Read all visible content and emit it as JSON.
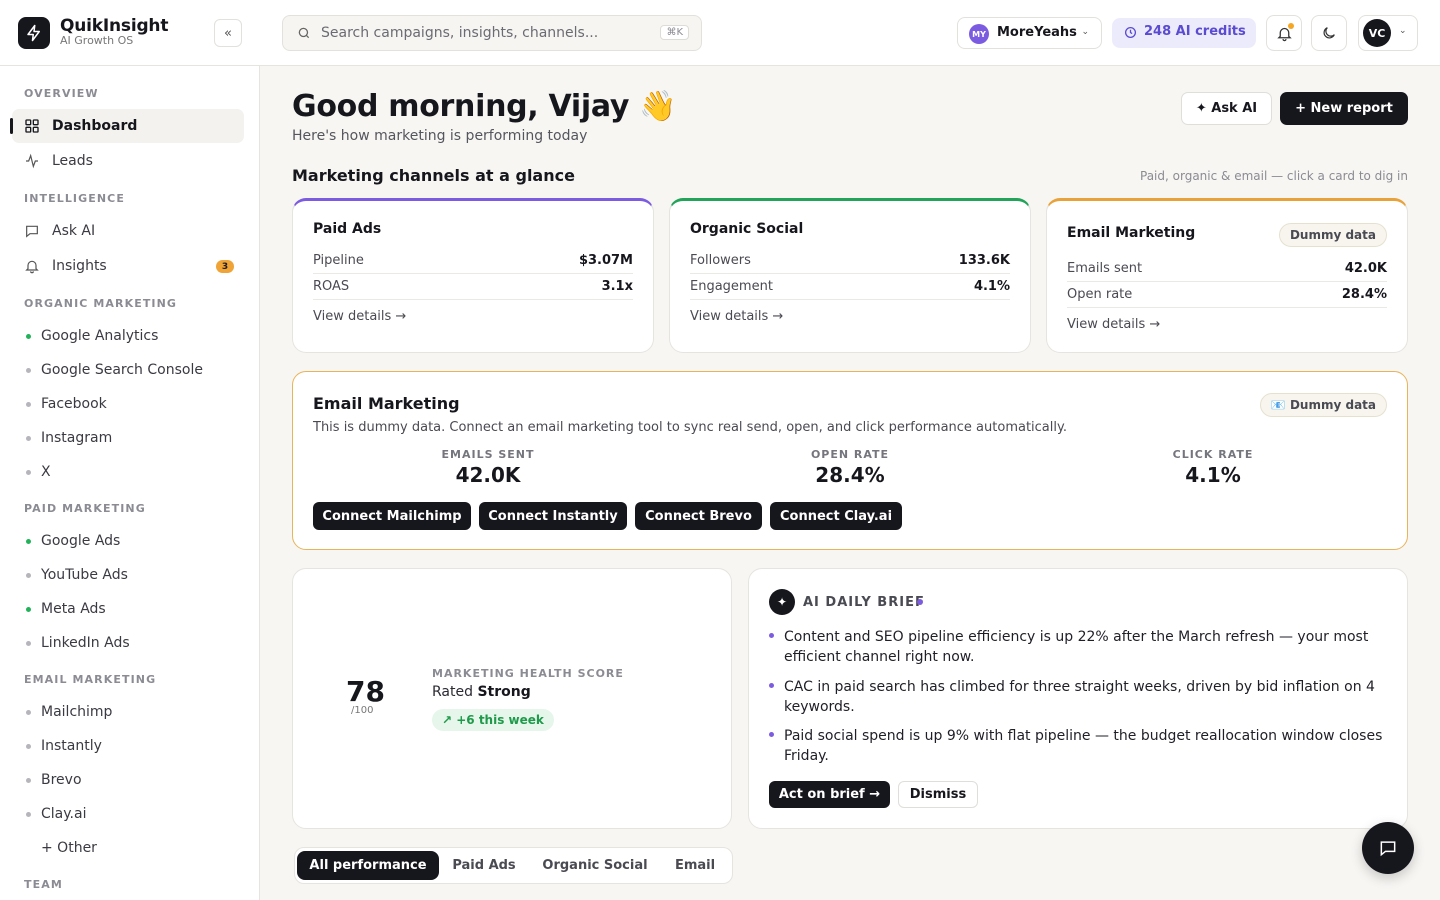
{
  "brand": {
    "name": "QuikInsight",
    "tagline": "AI Growth OS",
    "collapse_label": "«"
  },
  "search": {
    "placeholder": "Search campaigns, insights, channels...",
    "shortcut": "⌘K"
  },
  "workspace": {
    "initials": "MY",
    "name": "MoreYeahs"
  },
  "credits": {
    "label": "248 AI credits"
  },
  "user": {
    "initials": "VC"
  },
  "sidebar": {
    "sections": [
      {
        "title": "OVERVIEW",
        "items": [
          {
            "label": "Dashboard",
            "icon": "grid-icon",
            "active": true
          },
          {
            "label": "Leads",
            "icon": "activity-icon"
          }
        ]
      },
      {
        "title": "INTELLIGENCE",
        "items": [
          {
            "label": "Ask AI",
            "icon": "chat-icon"
          },
          {
            "label": "Insights",
            "icon": "bell-icon",
            "badge": "3"
          }
        ]
      },
      {
        "title": "ORGANIC MARKETING",
        "items": [
          {
            "label": "Google Analytics",
            "connected": true
          },
          {
            "label": "Google Search Console"
          },
          {
            "label": "Facebook"
          },
          {
            "label": "Instagram"
          },
          {
            "label": "X"
          }
        ]
      },
      {
        "title": "PAID MARKETING",
        "items": [
          {
            "label": "Google Ads",
            "connected": true
          },
          {
            "label": "YouTube Ads"
          },
          {
            "label": "Meta Ads",
            "connected": true
          },
          {
            "label": "LinkedIn Ads"
          }
        ]
      },
      {
        "title": "EMAIL MARKETING",
        "items": [
          {
            "label": "Mailchimp"
          },
          {
            "label": "Instantly"
          },
          {
            "label": "Brevo"
          },
          {
            "label": "Clay.ai"
          },
          {
            "label": "+ Other"
          }
        ]
      },
      {
        "title": "TEAM",
        "items": []
      }
    ]
  },
  "header": {
    "greeting": "Good morning, Vijay 👋",
    "subtitle": "Here's how marketing is performing today",
    "ask_ai": "✦ Ask AI",
    "new_report": "+ New report"
  },
  "channels": {
    "title": "Marketing channels at a glance",
    "hint": "Paid, organic & email — click a card to dig in",
    "cards": [
      {
        "name": "Paid Ads",
        "accent": "#7b5ce0",
        "rows": [
          {
            "label": "Pipeline",
            "value": "$3.07M"
          },
          {
            "label": "ROAS",
            "value": "3.1x"
          }
        ],
        "link": "View details →"
      },
      {
        "name": "Organic Social",
        "accent": "#22a35a",
        "rows": [
          {
            "label": "Followers",
            "value": "133.6K"
          },
          {
            "label": "Engagement",
            "value": "4.1%"
          }
        ],
        "link": "View details →"
      },
      {
        "name": "Email Marketing",
        "accent": "#e8a23a",
        "chip": "Dummy data",
        "rows": [
          {
            "label": "Emails sent",
            "value": "42.0K"
          },
          {
            "label": "Open rate",
            "value": "28.4%"
          }
        ],
        "link": "View details →"
      }
    ]
  },
  "email_card": {
    "title": "Email Marketing",
    "chip": "📧 Dummy data",
    "description": "This is dummy data. Connect an email marketing tool to sync real send, open, and click performance automatically.",
    "stats": [
      {
        "label": "EMAILS SENT",
        "value": "42.0K"
      },
      {
        "label": "OPEN RATE",
        "value": "28.4%"
      },
      {
        "label": "CLICK RATE",
        "value": "4.1%"
      }
    ],
    "buttons": [
      "Connect Mailchimp",
      "Connect Instantly",
      "Connect Brevo",
      "Connect Clay.ai"
    ]
  },
  "health": {
    "score": "78",
    "max": "/100",
    "label": "MARKETING HEALTH SCORE",
    "rated_prefix": "Rated ",
    "rating": "Strong",
    "delta": "↗ +6 this week"
  },
  "brief": {
    "title": "AI DAILY BRIEF",
    "items": [
      "Content and SEO pipeline efficiency is up 22% after the March refresh — your most efficient channel right now.",
      "CAC in paid search has climbed for three straight weeks, driven by bid inflation on 4 keywords.",
      "Paid social spend is up 9% with flat pipeline — the budget reallocation window closes Friday."
    ],
    "act": "Act on brief →",
    "dismiss": "Dismiss"
  },
  "tabs": [
    {
      "label": "All performance",
      "active": true
    },
    {
      "label": "Paid Ads"
    },
    {
      "label": "Organic Social"
    },
    {
      "label": "Email"
    }
  ]
}
